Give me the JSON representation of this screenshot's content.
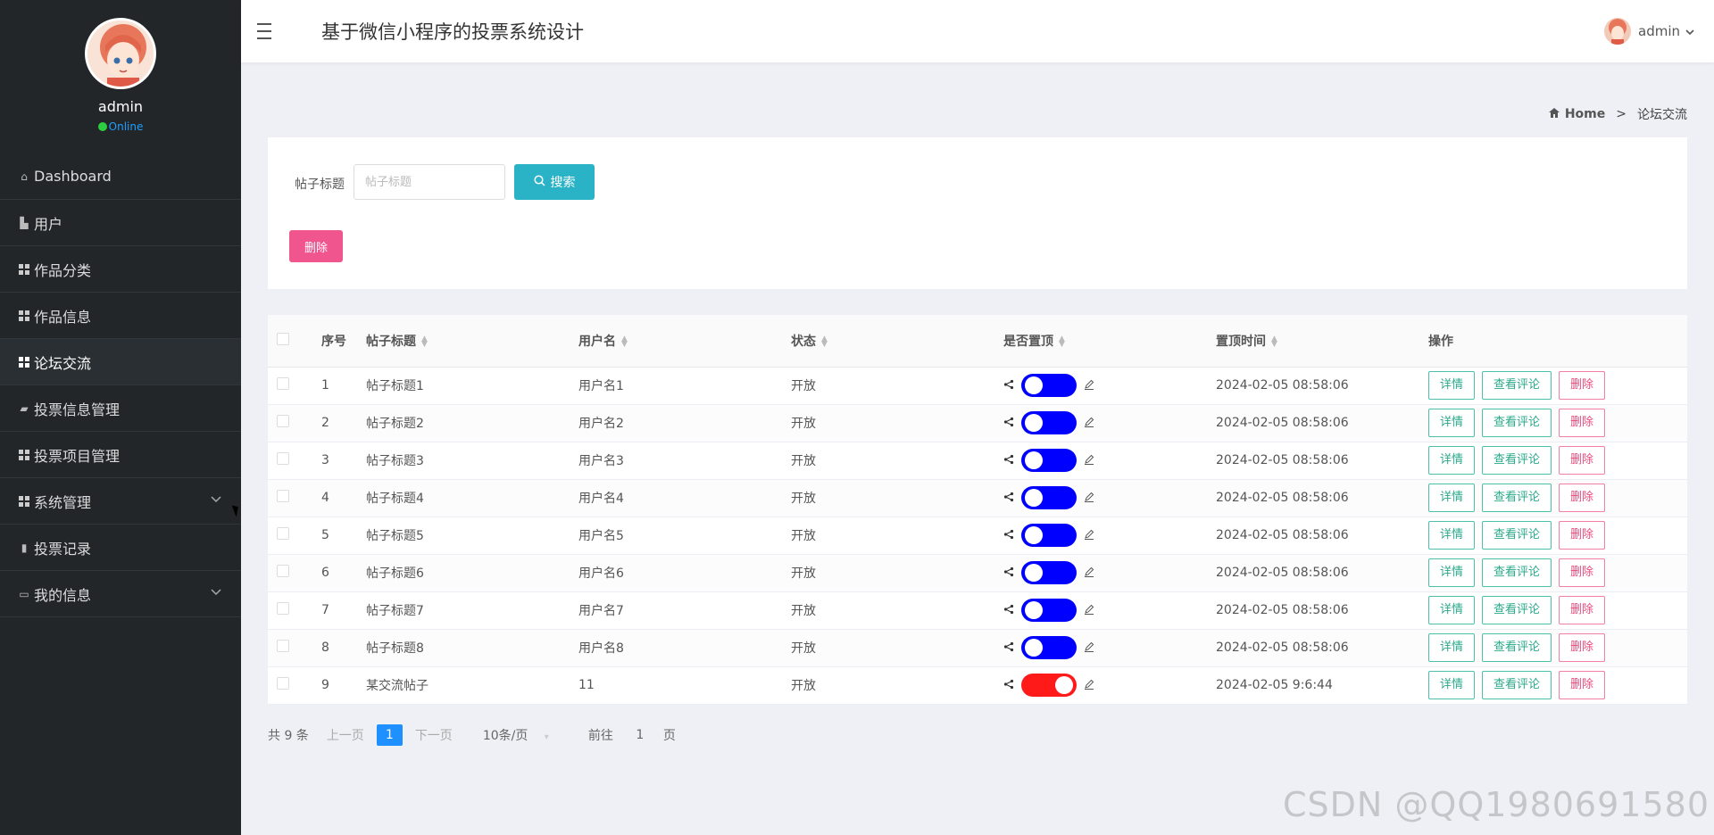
{
  "app": {
    "title": "基于微信小程序的投票系统设计"
  },
  "profile": {
    "name": "admin",
    "status": "Online"
  },
  "header": {
    "user": "admin"
  },
  "sidebar": {
    "items": [
      {
        "label": "Dashboard",
        "icon": "home-icon"
      },
      {
        "label": "用户",
        "icon": "chart-icon"
      },
      {
        "label": "作品分类",
        "icon": "grid-icon"
      },
      {
        "label": "作品信息",
        "icon": "grid-icon"
      },
      {
        "label": "论坛交流",
        "icon": "grid-icon",
        "active": true
      },
      {
        "label": "投票信息管理",
        "icon": "ticket-icon"
      },
      {
        "label": "投票项目管理",
        "icon": "grid-icon"
      },
      {
        "label": "系统管理",
        "icon": "grid-icon",
        "expandable": true
      },
      {
        "label": "投票记录",
        "icon": "bar-chart-icon"
      },
      {
        "label": "我的信息",
        "icon": "id-card-icon",
        "expandable": true
      }
    ]
  },
  "breadcrumb": {
    "home": "Home",
    "separator": ">",
    "current": "论坛交流"
  },
  "search": {
    "label": "帖子标题",
    "placeholder": "帖子标题",
    "button": "搜索",
    "delete": "删除"
  },
  "table": {
    "headers": [
      "序号",
      "帖子标题",
      "用户名",
      "状态",
      "是否置顶",
      "置顶时间",
      "操作"
    ],
    "actions": {
      "detail": "详情",
      "comments": "查看评论",
      "delete": "删除"
    },
    "rows": [
      {
        "no": "1",
        "title": "帖子标题1",
        "user": "用户名1",
        "status": "开放",
        "pinned": false,
        "time": "2024-02-05 08:58:06"
      },
      {
        "no": "2",
        "title": "帖子标题2",
        "user": "用户名2",
        "status": "开放",
        "pinned": false,
        "time": "2024-02-05 08:58:06"
      },
      {
        "no": "3",
        "title": "帖子标题3",
        "user": "用户名3",
        "status": "开放",
        "pinned": false,
        "time": "2024-02-05 08:58:06"
      },
      {
        "no": "4",
        "title": "帖子标题4",
        "user": "用户名4",
        "status": "开放",
        "pinned": false,
        "time": "2024-02-05 08:58:06"
      },
      {
        "no": "5",
        "title": "帖子标题5",
        "user": "用户名5",
        "status": "开放",
        "pinned": false,
        "time": "2024-02-05 08:58:06"
      },
      {
        "no": "6",
        "title": "帖子标题6",
        "user": "用户名6",
        "status": "开放",
        "pinned": false,
        "time": "2024-02-05 08:58:06"
      },
      {
        "no": "7",
        "title": "帖子标题7",
        "user": "用户名7",
        "status": "开放",
        "pinned": false,
        "time": "2024-02-05 08:58:06"
      },
      {
        "no": "8",
        "title": "帖子标题8",
        "user": "用户名8",
        "status": "开放",
        "pinned": false,
        "time": "2024-02-05 08:58:06"
      },
      {
        "no": "9",
        "title": "某交流帖子",
        "user": "11",
        "status": "开放",
        "pinned": true,
        "time": "2024-02-05 9:6:44"
      }
    ]
  },
  "pagination": {
    "total": "共 9 条",
    "prev": "上一页",
    "current": "1",
    "next": "下一页",
    "page_size": "10条/页",
    "goto_label": "前往",
    "goto_value": "1",
    "page_label": "页"
  },
  "watermark": "CSDN @QQ1980691580",
  "colors": {
    "sidebar_bg": "#222629",
    "search_btn": "#2ab3c6",
    "delete_btn": "#f0558d",
    "toggle_off": "#0000ff",
    "toggle_on": "#ff1a1a",
    "page_active": "#1e90ff"
  }
}
